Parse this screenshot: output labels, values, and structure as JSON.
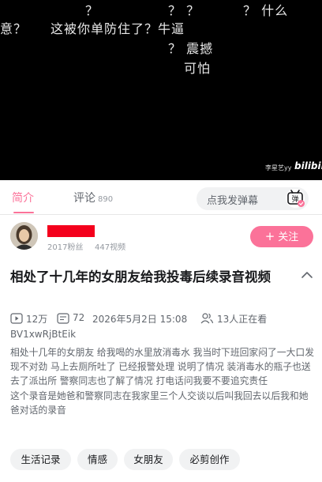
{
  "video": {
    "danmaku": [
      "？",
      "？ ？",
      "？ 什么",
      "意？",
      "这被你单防住了？牛逼",
      "？ 震撼",
      "可怕"
    ],
    "watermark_user": "李星艺yy",
    "watermark_logo": "bilibili"
  },
  "tabs": {
    "intro": "简介",
    "comments": "评论",
    "comments_count": "890"
  },
  "danmaku_input": {
    "placeholder": "点我发弹幕",
    "button_icon": "danmaku-toggle-icon"
  },
  "uploader": {
    "fans": "2017粉丝",
    "videos": "447视频",
    "follow_label": "关注",
    "follow_icon": "+"
  },
  "title": "相处了十几年的女朋友给我投毒后续录音视频",
  "meta": {
    "views": "12万",
    "danmaku_count": "72",
    "date": "2026年5月2日 15:08",
    "watching": "13人正在看",
    "bvid": "BV1xwRjBtEik"
  },
  "description": [
    "相处十几年的女朋友 给我喝的水里放消毒水 我当时下班回家闷了一大口发现不对劲 马上去厕所吐了 已经报警处理 说明了情况 装消毒水的瓶子也送去了派出所 警察同志也了解了情况 打电话问我要不要追究责任",
    "这个录音是她爸和警察同志在我家里三个人交谈以后叫我回去以后我和她爸对话的录音"
  ],
  "tags": [
    "生活记录",
    "情感",
    "女朋友",
    "必剪创作"
  ],
  "colors": {
    "accent": "#fb7299",
    "redaction": "#f4001c",
    "video_bg": "#000000"
  }
}
